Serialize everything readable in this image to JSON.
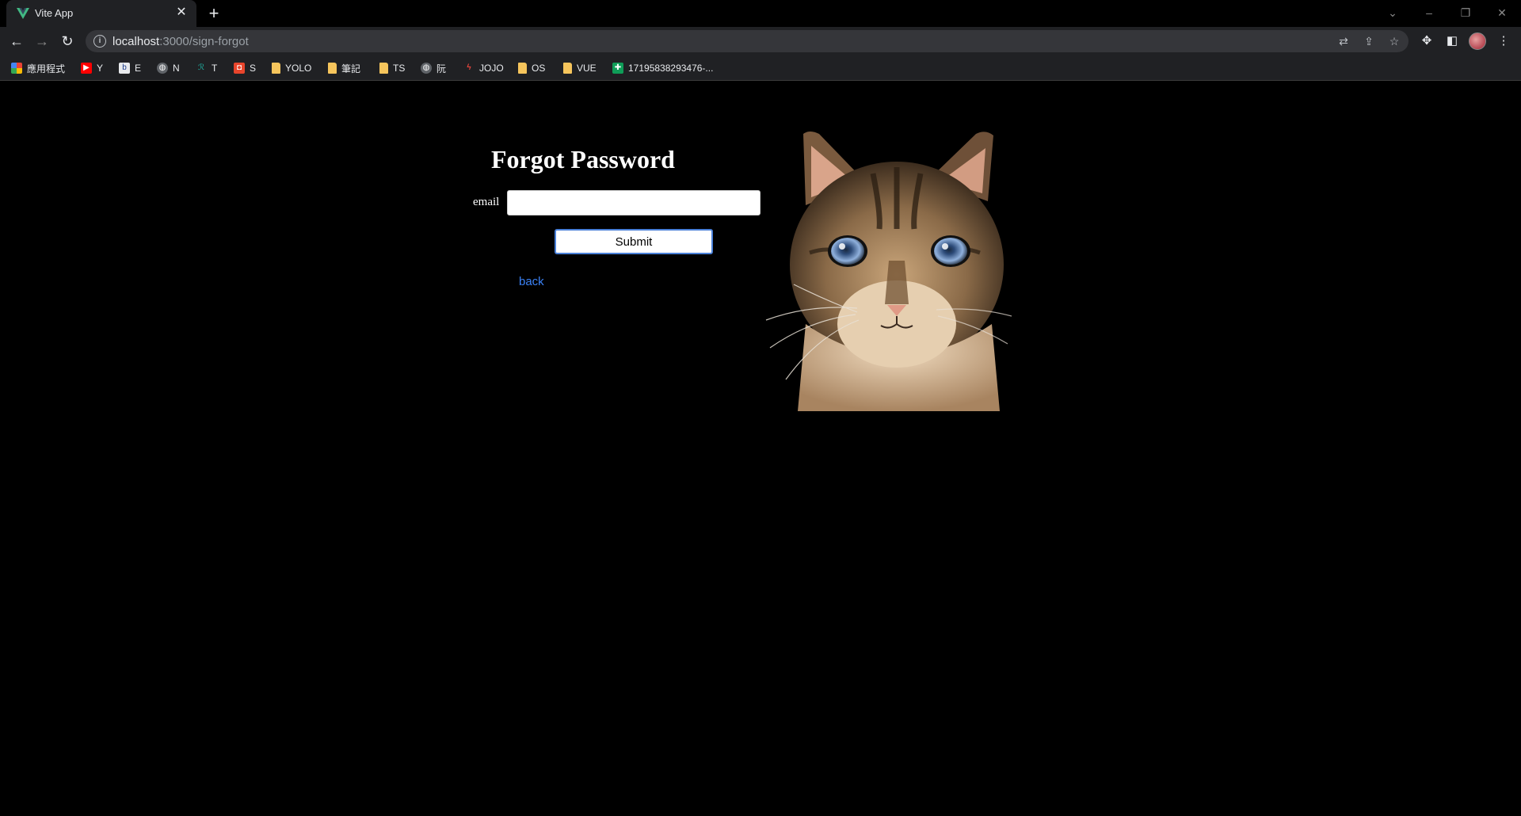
{
  "browser": {
    "tab_title": "Vite App",
    "url_host": "localhost",
    "url_path": ":3000/sign-forgot",
    "bookmarks": [
      {
        "label": "應用程式",
        "icon": "apps-grid-icon"
      },
      {
        "label": "Y",
        "icon": "youtube-icon"
      },
      {
        "label": "E",
        "icon": "site-icon"
      },
      {
        "label": "N",
        "icon": "globe-icon"
      },
      {
        "label": "T",
        "icon": "site-icon"
      },
      {
        "label": "S",
        "icon": "bag-icon"
      },
      {
        "label": "YOLO",
        "icon": "folder-icon"
      },
      {
        "label": "筆記",
        "icon": "folder-icon"
      },
      {
        "label": "TS",
        "icon": "folder-icon"
      },
      {
        "label": "阮",
        "icon": "globe-icon"
      },
      {
        "label": "JOJO",
        "icon": "site-icon"
      },
      {
        "label": "OS",
        "icon": "folder-icon"
      },
      {
        "label": "VUE",
        "icon": "folder-icon"
      },
      {
        "label": "17195838293476-...",
        "icon": "sheets-icon"
      }
    ]
  },
  "form": {
    "title": "Forgot Password",
    "email_label": "email",
    "email_value": "",
    "submit_label": "Submit",
    "back_label": "back"
  },
  "colors": {
    "page_background": "#000000",
    "link": "#3b82f6",
    "submit_border": "#4a80d8"
  }
}
